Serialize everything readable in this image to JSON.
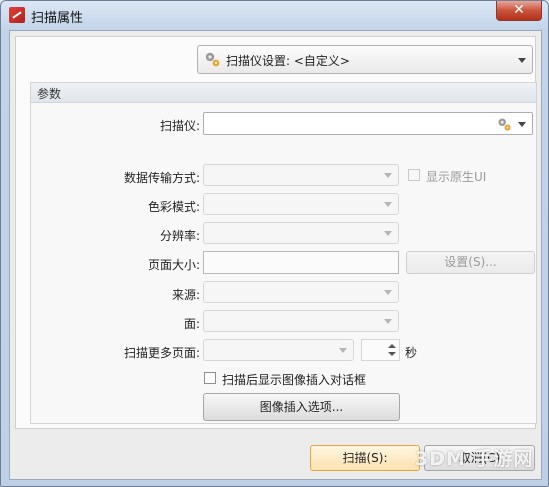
{
  "window": {
    "title": "扫描属性",
    "close": "✕"
  },
  "scanner_settings": {
    "label": "扫描仪设置:",
    "value": "<自定义>"
  },
  "params_group": {
    "title": "参数"
  },
  "fields": {
    "scanner": {
      "label": "扫描仪:",
      "value": ""
    },
    "transfer_mode": {
      "label": "数据传输方式:",
      "value": ""
    },
    "show_native_ui": {
      "label": "显示原生UI",
      "checked": false
    },
    "color_mode": {
      "label": "色彩模式:",
      "value": ""
    },
    "resolution": {
      "label": "分辨率:",
      "value": ""
    },
    "page_size": {
      "label": "页面大小:",
      "value": ""
    },
    "page_size_settings": {
      "label": "设置(S)..."
    },
    "source": {
      "label": "来源:",
      "value": ""
    },
    "side": {
      "label": "面:",
      "value": ""
    },
    "scan_more": {
      "label": "扫描更多页面:",
      "value": "",
      "seconds_value": "",
      "seconds_unit": "秒"
    },
    "show_insert_dialog": {
      "label": "扫描后显示图像插入对话框",
      "checked": false
    },
    "insert_options": {
      "label": "图像插入选项..."
    }
  },
  "buttons": {
    "scan": "扫描(S):",
    "cancel": "取消(C)"
  },
  "watermark": "3DM 手游网",
  "colors": {
    "accent_border": "#e4a441",
    "close_button": "#c9533c"
  },
  "icons": [
    "gear-icon",
    "close-icon",
    "chevron-down-icon",
    "app-icon"
  ]
}
